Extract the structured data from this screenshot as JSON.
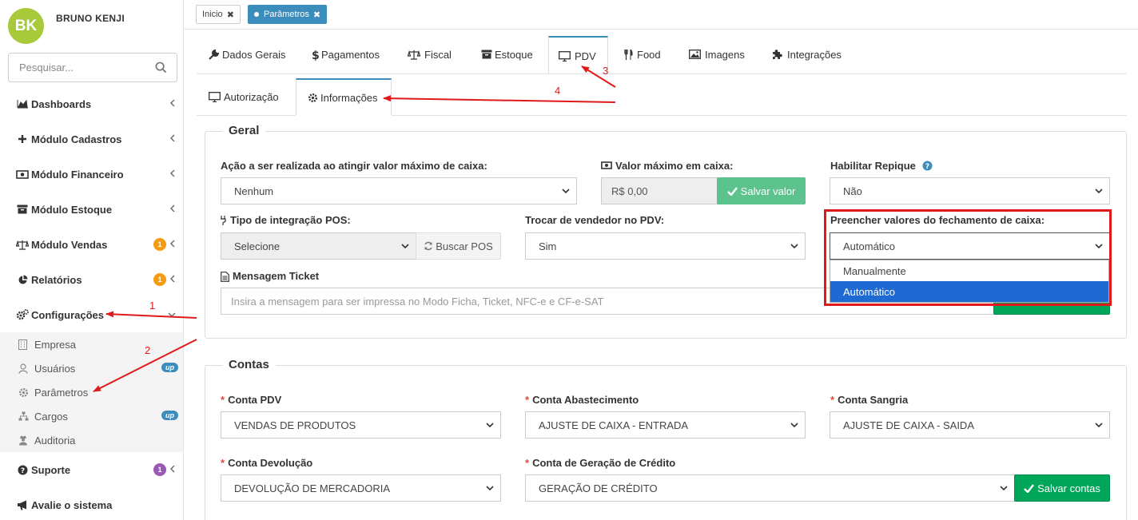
{
  "user": {
    "initials": "BK",
    "name": "BRUNO KENJI"
  },
  "search": {
    "placeholder": "Pesquisar..."
  },
  "menu": [
    {
      "label": "Dashboards",
      "icon": "area-chart-icon"
    },
    {
      "label": "Módulo Cadastros",
      "icon": "plus-icon"
    },
    {
      "label": "Módulo Financeiro",
      "icon": "money-icon"
    },
    {
      "label": "Módulo Estoque",
      "icon": "archive-icon"
    },
    {
      "label": "Módulo Vendas",
      "icon": "balance-scale-icon",
      "badge": "1"
    },
    {
      "label": "Relatórios",
      "icon": "pie-chart-icon",
      "badge": "1"
    },
    {
      "label": "Configurações",
      "icon": "gears-icon"
    },
    {
      "label": "Suporte",
      "icon": "question-circle-icon",
      "badge": "1"
    },
    {
      "label": "Avalie o sistema",
      "icon": "bullhorn-icon"
    }
  ],
  "submenu": [
    {
      "label": "Empresa",
      "icon": "building-icon"
    },
    {
      "label": "Usuários",
      "icon": "user-icon",
      "badge": "up"
    },
    {
      "label": "Parâmetros",
      "icon": "cog-icon"
    },
    {
      "label": "Cargos",
      "icon": "sitemap-icon",
      "badge": "up"
    },
    {
      "label": "Auditoria",
      "icon": "user-secret-icon"
    }
  ],
  "open_tabs": [
    {
      "label": "Inicio"
    },
    {
      "label": "Parâmetros"
    }
  ],
  "tabs": [
    {
      "label": "Dados Gerais",
      "icon": "wrench-icon"
    },
    {
      "label": "Pagamentos",
      "icon": "dollar-icon"
    },
    {
      "label": "Fiscal",
      "icon": "balance-scale-icon"
    },
    {
      "label": "Estoque",
      "icon": "archive-icon"
    },
    {
      "label": "PDV",
      "icon": "desktop-icon"
    },
    {
      "label": "Food",
      "icon": "cutlery-icon"
    },
    {
      "label": "Imagens",
      "icon": "image-icon"
    },
    {
      "label": "Integrações",
      "icon": "puzzle-icon"
    }
  ],
  "subtabs": [
    {
      "label": "Autorização",
      "icon": "desktop-icon"
    },
    {
      "label": "Informações",
      "icon": "cog-icon"
    }
  ],
  "geral": {
    "legend": "Geral",
    "acao_label": "Ação a ser realizada ao atingir valor máximo de caixa:",
    "acao_value": "Nenhum",
    "valor_max_label": "Valor máximo em caixa:",
    "valor_max_value": "R$ 0,00",
    "salvar_valor": "Salvar valor",
    "repique_label": "Habilitar Repique",
    "repique_value": "Não",
    "tipo_pos_label": "Tipo de integração POS:",
    "tipo_pos_value": "Selecione",
    "buscar_pos": "Buscar POS",
    "trocar_label": "Trocar de vendedor no PDV:",
    "trocar_value": "Sim",
    "preencher_label": "Preencher valores do fechamento de caixa:",
    "preencher_value": "Automático",
    "preencher_options": [
      "Manualmente",
      "Automático"
    ],
    "mensagem_label": "Mensagem Ticket",
    "mensagem_placeholder": "Insira a mensagem para ser impressa no Modo Ficha, Ticket, NFC-e e CF-e-SAT"
  },
  "contas": {
    "legend": "Contas",
    "pdv_label": "Conta PDV",
    "pdv_value": "VENDAS DE PRODUTOS",
    "abast_label": "Conta Abastecimento",
    "abast_value": "AJUSTE DE CAIXA - ENTRADA",
    "sangria_label": "Conta Sangria",
    "sangria_value": "AJUSTE DE CAIXA - SAIDA",
    "devol_label": "Conta Devolução",
    "devol_value": "DEVOLUÇÃO DE MERCADORIA",
    "credito_label": "Conta de Geração de Crédito",
    "credito_value": "GERAÇÃO DE CRÉDITO",
    "salvar_contas": "Salvar contas",
    "required_mark": "*"
  },
  "annotations": [
    "1",
    "2",
    "3",
    "4"
  ],
  "colors": {
    "primary": "#3c8dbc",
    "success": "#00a65a",
    "annotation": "#e01a1a",
    "avatar": "#a8c93a",
    "badge_orange": "#f39c12",
    "badge_purple": "#9b59b6"
  }
}
